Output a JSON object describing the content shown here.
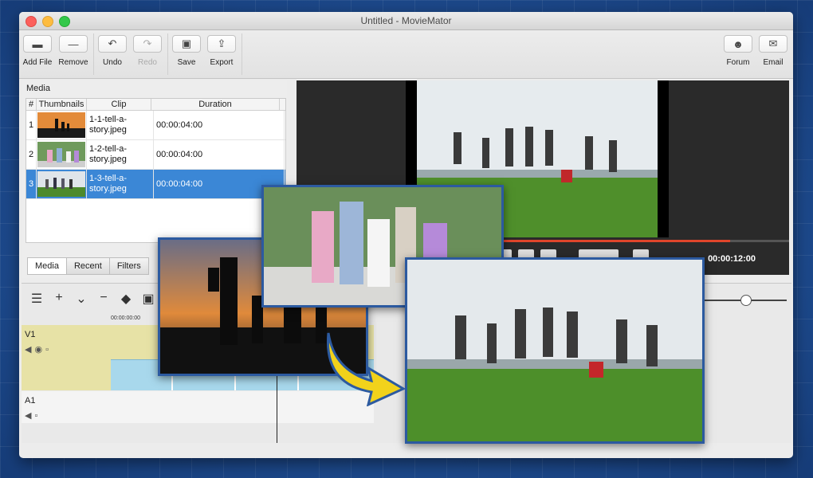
{
  "window": {
    "title": "Untitled - MovieMator"
  },
  "toolbar": {
    "add_file": "Add File",
    "remove": "Remove",
    "undo": "Undo",
    "redo": "Redo",
    "save": "Save",
    "export": "Export",
    "forum": "Forum",
    "email": "Email"
  },
  "media": {
    "panel_title": "Media",
    "columns": {
      "num": "#",
      "thumbnails": "Thumbnails",
      "clip": "Clip",
      "duration": "Duration"
    },
    "rows": [
      {
        "num": "1",
        "clip_line1": "1-1-tell-a-",
        "clip_line2": "story.jpeg",
        "duration": "00:00:04:00"
      },
      {
        "num": "2",
        "clip_line1": "1-2-tell-a-",
        "clip_line2": "story.jpeg",
        "duration": "00:00:04:00"
      },
      {
        "num": "3",
        "clip_line1": "1-3-tell-a-",
        "clip_line2": "story.jpeg",
        "duration": "00:00:04:00"
      }
    ],
    "selected_row": 3,
    "tabs": [
      "Media",
      "Recent",
      "Filters"
    ]
  },
  "preview": {
    "time": "00:00:12:00",
    "progress": 0.88
  },
  "timeline": {
    "ruler_start": "00:00:00:00",
    "tracks": [
      "V1",
      "A1"
    ]
  },
  "colors": {
    "selection": "#3b87d6",
    "progress": "#e0452b",
    "video_track": "#e7e2a6",
    "clip": "#a8d8ec",
    "arrow": "#f2d21b"
  }
}
